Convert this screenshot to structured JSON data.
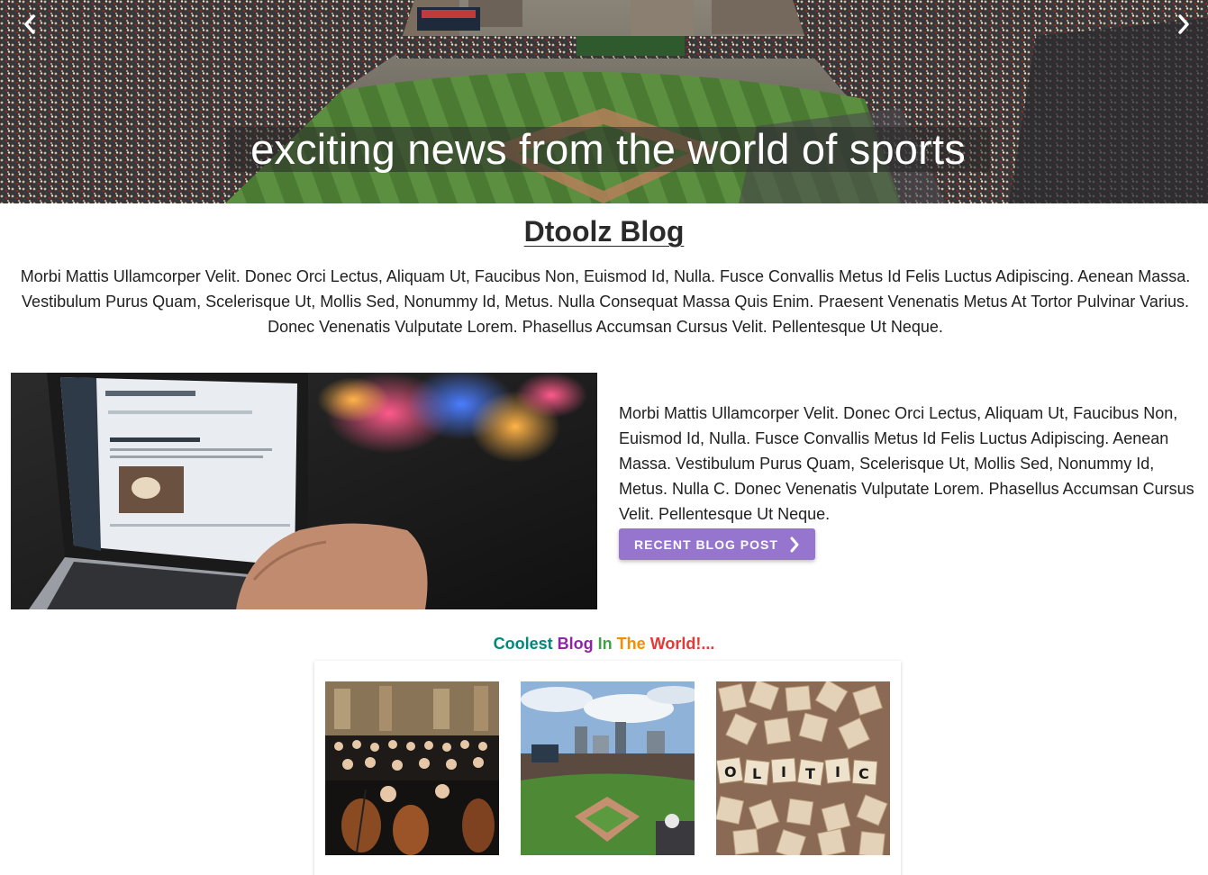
{
  "hero": {
    "caption": "exciting news from the world of sports",
    "prev_icon": "chevron-left-icon",
    "next_icon": "chevron-right-icon"
  },
  "blog": {
    "title": "Dtoolz Blog",
    "intro": "Morbi Mattis Ullamcorper Velit. Donec Orci Lectus, Aliquam Ut, Faucibus Non, Euismod Id, Nulla. Fusce Convallis Metus Id Felis Luctus Adipiscing. Aenean Massa. Vestibulum Purus Quam, Scelerisque Ut, Mollis Sed, Nonummy Id, Metus. Nulla Consequat Massa Quis Enim. Praesent Venenatis Metus At Tortor Pulvinar Varius. Donec Venenatis Vulputate Lorem. Phasellus Accumsan Cursus Velit. Pellentesque Ut Neque."
  },
  "feature": {
    "text": "Morbi Mattis Ullamcorper Velit. Donec Orci Lectus, Aliquam Ut, Faucibus Non, Euismod Id, Nulla. Fusce Convallis Metus Id Felis Luctus Adipiscing. Aenean Massa. Vestibulum Purus Quam, Scelerisque Ut, Mollis Sed, Nonummy Id, Metus. Nulla C. Donec Venenatis Vulputate Lorem. Phasellus Accumsan Cursus Velit. Pellentesque Ut Neque.",
    "button_label": "RECENT BLOG POST",
    "button_icon": "chevron-right-icon",
    "button_color": "#9575cd"
  },
  "coolest": {
    "words": [
      {
        "text": "Coolest",
        "color": "#00897b"
      },
      {
        "text": "Blog",
        "color": "#8e24aa"
      },
      {
        "text": "In",
        "color": "#43a047"
      },
      {
        "text": "The",
        "color": "#fb8c00"
      },
      {
        "text": "World!...",
        "color": "#e53935"
      }
    ]
  },
  "gallery": {
    "items": [
      "orchestra-photo",
      "stadium-photo",
      "scrabble-tiles-photo"
    ],
    "tiles_text": "O L I T I C"
  }
}
